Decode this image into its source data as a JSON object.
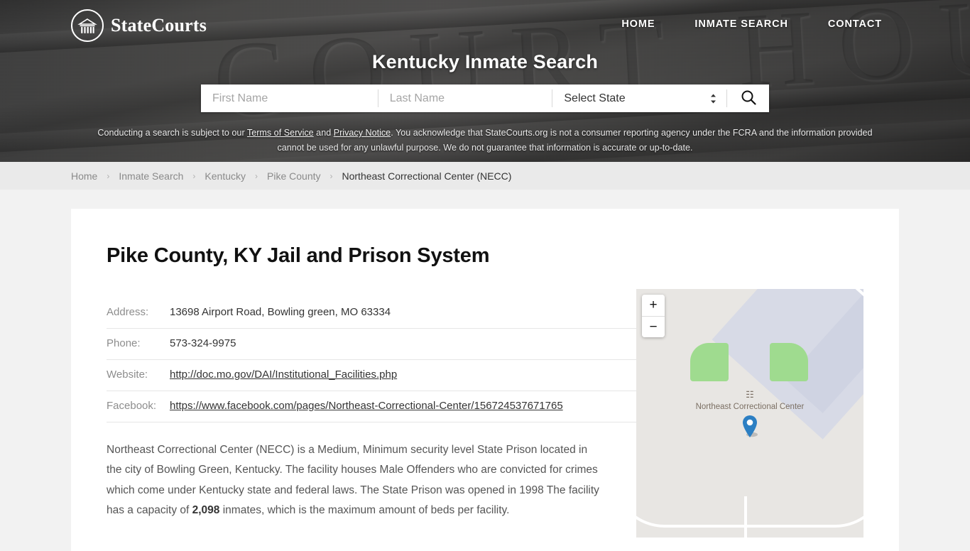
{
  "header": {
    "facade_engraving": "COURT HOUSE",
    "logo": {
      "text": "StateCourts",
      "icon": "courthouse-icon"
    },
    "nav": [
      {
        "label": "HOME"
      },
      {
        "label": "INMATE SEARCH"
      },
      {
        "label": "CONTACT"
      }
    ],
    "hero_title": "Kentucky Inmate Search",
    "search": {
      "first_name_placeholder": "First Name",
      "first_name_value": "",
      "last_name_placeholder": "Last Name",
      "last_name_value": "",
      "state_selected": "Select State",
      "state_options": [
        "Select State"
      ],
      "search_icon": "search-icon"
    },
    "disclaimer": {
      "part1": "Conducting a search is subject to our ",
      "link1": "Terms of Service",
      "part2": " and ",
      "link2": "Privacy Notice",
      "part3": ". You acknowledge that StateCourts.org is not a consumer reporting agency under the FCRA and the information provided cannot be used for any unlawful purpose. We do not guarantee that information is accurate or up-to-date."
    }
  },
  "breadcrumb": [
    {
      "label": "Home",
      "current": false
    },
    {
      "label": "Inmate Search",
      "current": false
    },
    {
      "label": "Kentucky",
      "current": false
    },
    {
      "label": "Pike County",
      "current": false
    },
    {
      "label": "Northeast Correctional Center (NECC)",
      "current": true
    }
  ],
  "breadcrumb_separator": "›",
  "main": {
    "page_title": "Pike County, KY Jail and Prison System",
    "details": [
      {
        "label": "Address:",
        "value": "13698 Airport Road, Bowling green, MO 63334",
        "is_link": false
      },
      {
        "label": "Phone:",
        "value": "573-324-9975",
        "is_link": false
      },
      {
        "label": "Website:",
        "value": "http://doc.mo.gov/DAI/Institutional_Facilities.php",
        "is_link": true
      },
      {
        "label": "Facebook:",
        "value": "https://www.facebook.com/pages/Northeast-Correctional-Center/156724537671765",
        "is_link": true
      }
    ],
    "description": {
      "before_bold": "Northeast Correctional Center (NECC) is a Medium, Minimum security level State Prison located in the city of Bowling Green, Kentucky. The facility houses Male Offenders who are convicted for crimes which come under Kentucky state and federal laws. The State Prison was opened in 1998 The facility has a capacity of ",
      "bold": "2,098",
      "after_bold": " inmates, which is the maximum amount of beds per facility."
    }
  },
  "map": {
    "zoom_in_label": "+",
    "zoom_out_label": "−",
    "poi_glyph": "☷",
    "poi_name": "Northeast Correctional Center",
    "marker": "map-pin-marker",
    "colors": {
      "background": "#e8e6e3",
      "park": "#9fdb8f",
      "road": "#ffffff",
      "water": "#d7dae6",
      "pin": "#2c7fc3",
      "label_text": "#7b6f63"
    }
  },
  "theme": {
    "page_background": "#f2f2f2",
    "breadcrumb_background": "#eaeaea",
    "card_background": "#ffffff",
    "header_overlay": "#2c2c2c"
  }
}
